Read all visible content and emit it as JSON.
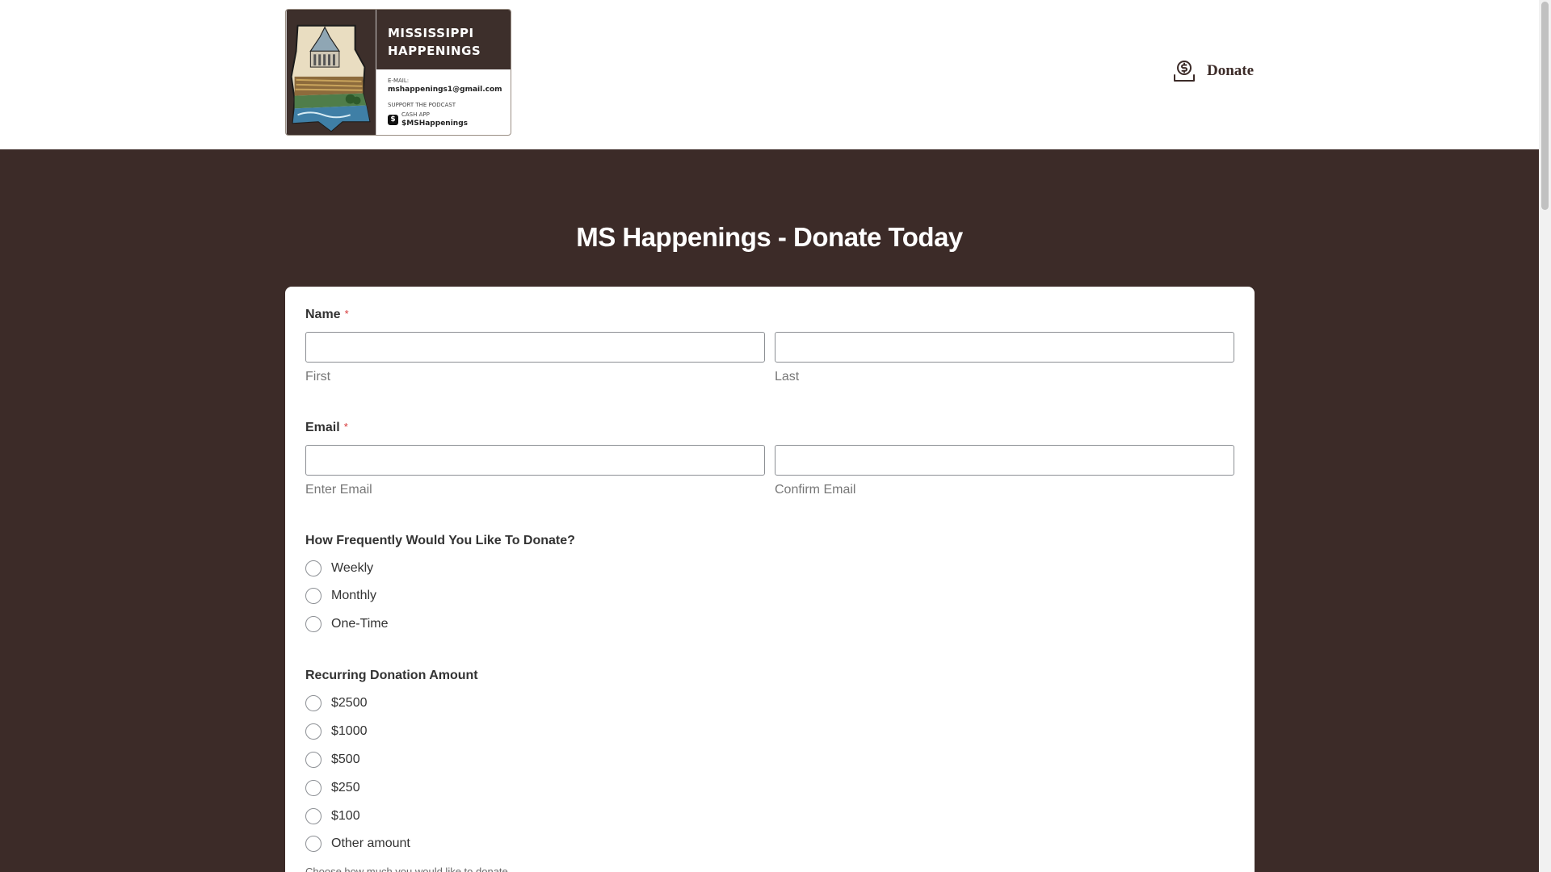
{
  "header": {
    "logo": {
      "title_line1": "MISSISSIPPI",
      "title_line2": "HAPPENINGS",
      "email_label": "E-MAIL:",
      "email": "mshappenings1@gmail.com",
      "support_label": "SUPPORT THE PODCAST",
      "cash_app_label": "CASH APP",
      "cash_tag": "$MSHappenings"
    },
    "donate_label": "Donate"
  },
  "page_title": "MS Happenings - Donate Today",
  "form": {
    "name": {
      "label": "Name",
      "required_mark": "*",
      "first_value": "",
      "last_value": "",
      "first_sublabel": "First",
      "last_sublabel": "Last"
    },
    "email": {
      "label": "Email",
      "required_mark": "*",
      "enter_value": "",
      "confirm_value": "",
      "enter_sublabel": "Enter Email",
      "confirm_sublabel": "Confirm Email"
    },
    "frequency": {
      "label": "How Frequently Would You Like To Donate?",
      "options": [
        "Weekly",
        "Monthly",
        "One-Time"
      ]
    },
    "amount": {
      "label": "Recurring Donation Amount",
      "options": [
        "$2500",
        "$1000",
        "$500",
        "$250",
        "$100",
        "Other amount"
      ],
      "help": "Choose how much you would like to donate."
    }
  },
  "colors": {
    "brand_dark": "#3c2b28",
    "required": "#d63637",
    "page_bg": "#3c2b28"
  }
}
